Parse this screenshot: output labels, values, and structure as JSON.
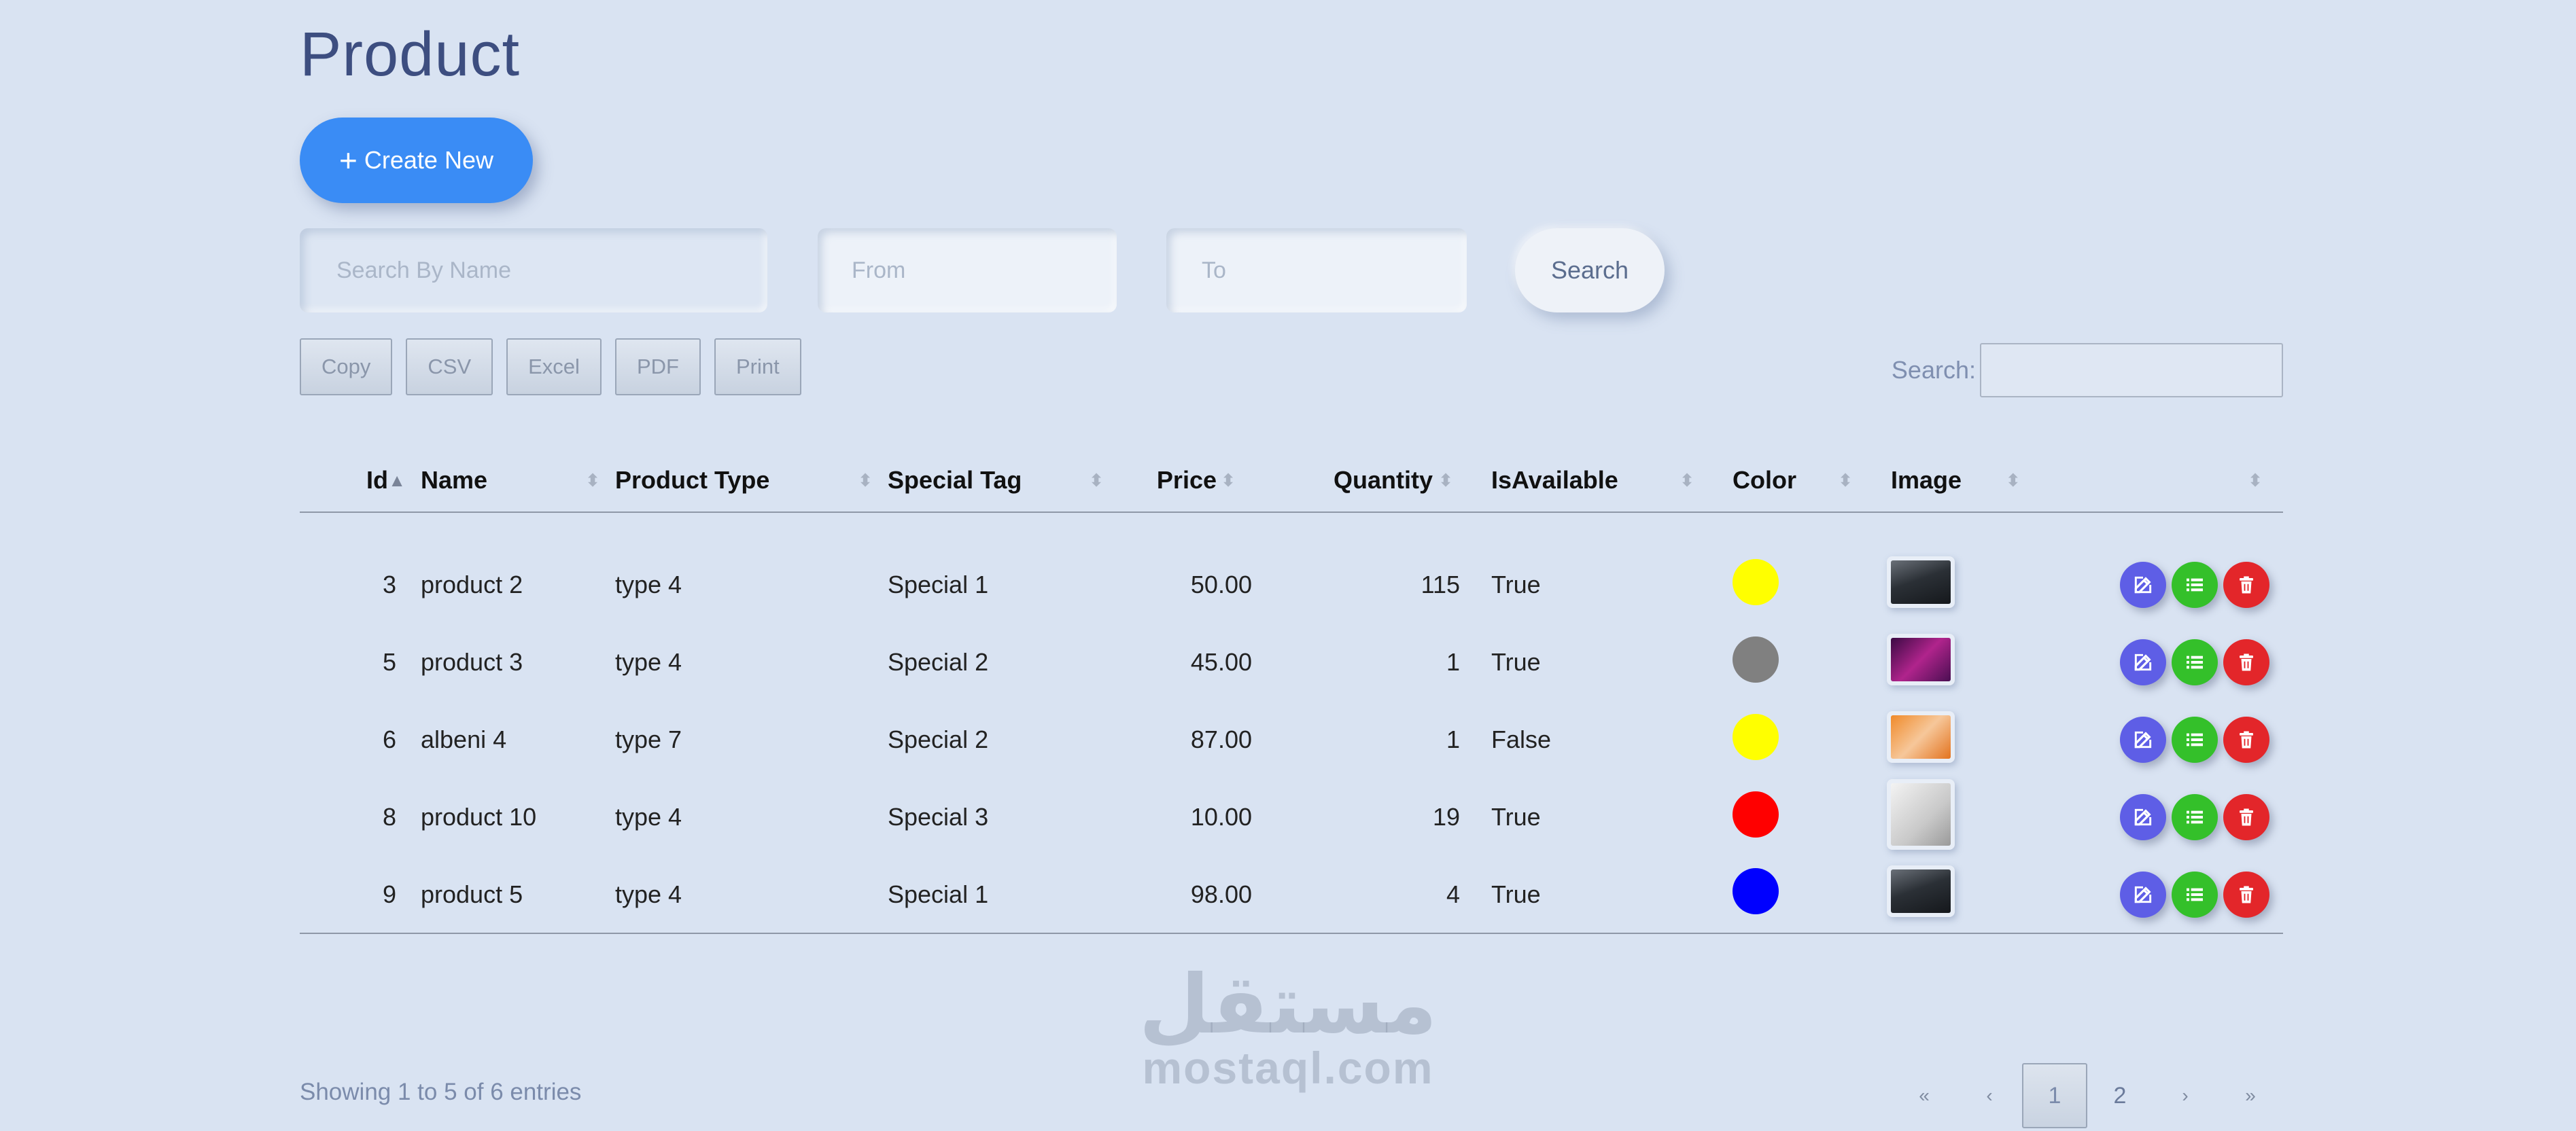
{
  "page": {
    "title": "Product"
  },
  "toolbar": {
    "create_label": "Create New",
    "create_icon": "plus-icon"
  },
  "filters": {
    "name_placeholder": "Search By Name",
    "from_placeholder": "From",
    "to_placeholder": "To",
    "search_label": "Search"
  },
  "export": {
    "copy": "Copy",
    "csv": "CSV",
    "excel": "Excel",
    "pdf": "PDF",
    "print": "Print"
  },
  "table_search": {
    "label": "Search:"
  },
  "columns": {
    "id": "Id",
    "name": "Name",
    "product_type": "Product Type",
    "special_tag": "Special Tag",
    "price": "Price",
    "quantity": "Quantity",
    "is_available": "IsAvailable",
    "color": "Color",
    "image": "Image"
  },
  "rows": [
    {
      "id": "3",
      "name": "product 2",
      "type": "type 4",
      "tag": "Special 1",
      "price": "50.00",
      "qty": "115",
      "avail": "True",
      "color": "#ffff00",
      "image": "laptop-dark"
    },
    {
      "id": "5",
      "name": "product 3",
      "type": "type 4",
      "tag": "Special 2",
      "price": "45.00",
      "qty": "1",
      "avail": "True",
      "color": "#808080",
      "image": "laptop-purple"
    },
    {
      "id": "6",
      "name": "albeni 4",
      "type": "type 7",
      "tag": "Special 2",
      "price": "87.00",
      "qty": "1",
      "avail": "False",
      "color": "#ffff00",
      "image": "products-orange"
    },
    {
      "id": "8",
      "name": "product 10",
      "type": "type 4",
      "tag": "Special 3",
      "price": "10.00",
      "qty": "19",
      "avail": "True",
      "color": "#ff0000",
      "image": "lamp-room"
    },
    {
      "id": "9",
      "name": "product 5",
      "type": "type 4",
      "tag": "Special 1",
      "price": "98.00",
      "qty": "4",
      "avail": "True",
      "color": "#0000ff",
      "image": "laptop-dark"
    }
  ],
  "footer": {
    "info": "Showing 1 to 5 of 6 entries"
  },
  "pagination": {
    "first": "«",
    "prev": "‹",
    "page1": "1",
    "page2": "2",
    "next": "›",
    "last": "»"
  },
  "watermark": {
    "arabic": "مستقل",
    "latin": "mostaql.com"
  },
  "colors": {
    "accent": "#3a8cf5",
    "edit": "#5e5ee6",
    "details": "#34c02a",
    "delete": "#e3262a"
  }
}
